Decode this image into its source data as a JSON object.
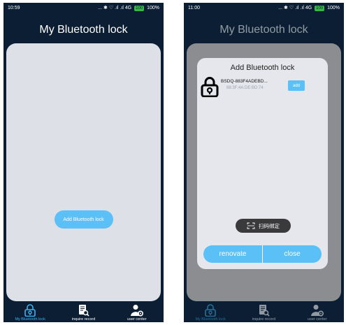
{
  "colors": {
    "background": "#0b1e33",
    "panel": "#dde0e6",
    "accent": "#5bc0f6",
    "active_tab": "#3ab4f2",
    "overlay": "#8c8d91",
    "dialog": "#e5e7ec"
  },
  "left": {
    "status": {
      "time": "10:59",
      "icons": "... ✱ ♡ .ıl .ıl 4G",
      "battery": "100",
      "battery_pct": "100%"
    },
    "title": "My Bluetooth lock",
    "add_button": "Add Bluetooth lock",
    "nav": [
      {
        "label": "My Bluetooth lock",
        "icon": "lock-icon",
        "active": true
      },
      {
        "label": "inquire record",
        "icon": "document-search-icon",
        "active": false
      },
      {
        "label": "user center",
        "icon": "user-settings-icon",
        "active": false
      }
    ]
  },
  "right": {
    "status": {
      "time": "11:00",
      "icons": "... ✱ ♡ .ıl .ıl 4G",
      "battery": "100",
      "battery_pct": "100%"
    },
    "title": "My Bluetooth lock",
    "dialog": {
      "title": "Add Bluetooth lock",
      "device_name": "BSDQ-883F4ADEBD...",
      "device_mac": "88:3F:4A:DE:BD:74",
      "add_label": "add",
      "scan_label": "扫码绑定",
      "renovate_label": "renovate",
      "close_label": "close"
    },
    "nav": [
      {
        "label": "My Bluetooth lock",
        "icon": "lock-icon",
        "active": true
      },
      {
        "label": "inquire record",
        "icon": "document-search-icon",
        "active": false
      },
      {
        "label": "user center",
        "icon": "user-settings-icon",
        "active": false
      }
    ]
  }
}
